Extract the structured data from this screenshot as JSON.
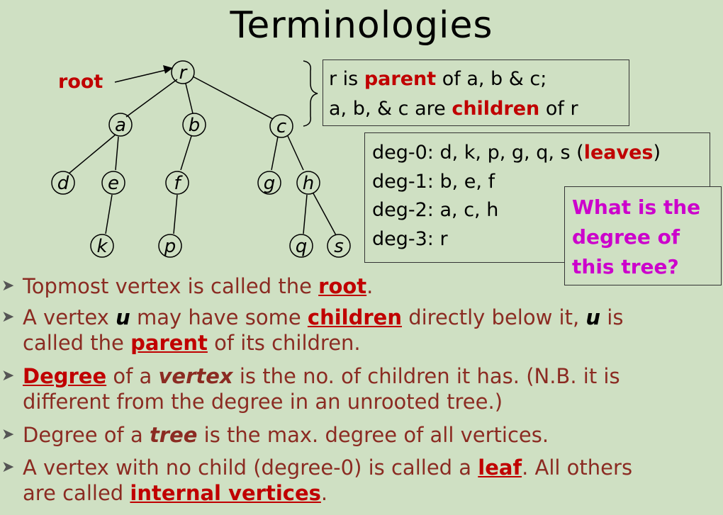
{
  "title": "Terminologies",
  "tree": {
    "root_label": "root",
    "nodes": [
      "r",
      "a",
      "b",
      "c",
      "d",
      "e",
      "f",
      "g",
      "h",
      "k",
      "p",
      "q",
      "s"
    ]
  },
  "parent_box": {
    "l1_a": "r is ",
    "l1_b": "parent",
    "l1_c": " of a, b & c;",
    "l2_a": "a, b, & c are ",
    "l2_b": "children",
    "l2_c": " of r"
  },
  "degree_box": {
    "deg0_a": "deg-0: d, k, p, g, q, s (",
    "deg0_b": "leaves",
    "deg0_c": ")",
    "deg1": "deg-1: b, e, f",
    "deg2": "deg-2: a, c, h",
    "deg3": "deg-3: r"
  },
  "question": {
    "l1": "What is the",
    "l2": "degree of",
    "l3": "this tree?"
  },
  "bullets": {
    "b1_a": "Topmost vertex is called the ",
    "b1_b": "root",
    "b1_c": ".",
    "b2_a": "A vertex ",
    "b2_b": "u",
    "b2_c": " may have some ",
    "b2_d": "children",
    "b2_e": " directly below it, ",
    "b2_f": "u",
    "b2_g": " is",
    "b2_h": "called the ",
    "b2_i": "parent",
    "b2_j": " of its children.",
    "b3_a": "Degree",
    "b3_b": " of a ",
    "b3_c": "vertex",
    "b3_d": " is the no. of children it has. (N.B. it is",
    "b3_e": "different from the degree in an unrooted tree.)",
    "b4_a": "Degree of a ",
    "b4_b": "tree",
    "b4_c": " is the max. degree of all vertices.",
    "b5_a": "A vertex with no child (degree-0) is called a ",
    "b5_b": "leaf",
    "b5_c": ". All others",
    "b5_d": "are called ",
    "b5_e": "internal vertices",
    "b5_f": "."
  }
}
